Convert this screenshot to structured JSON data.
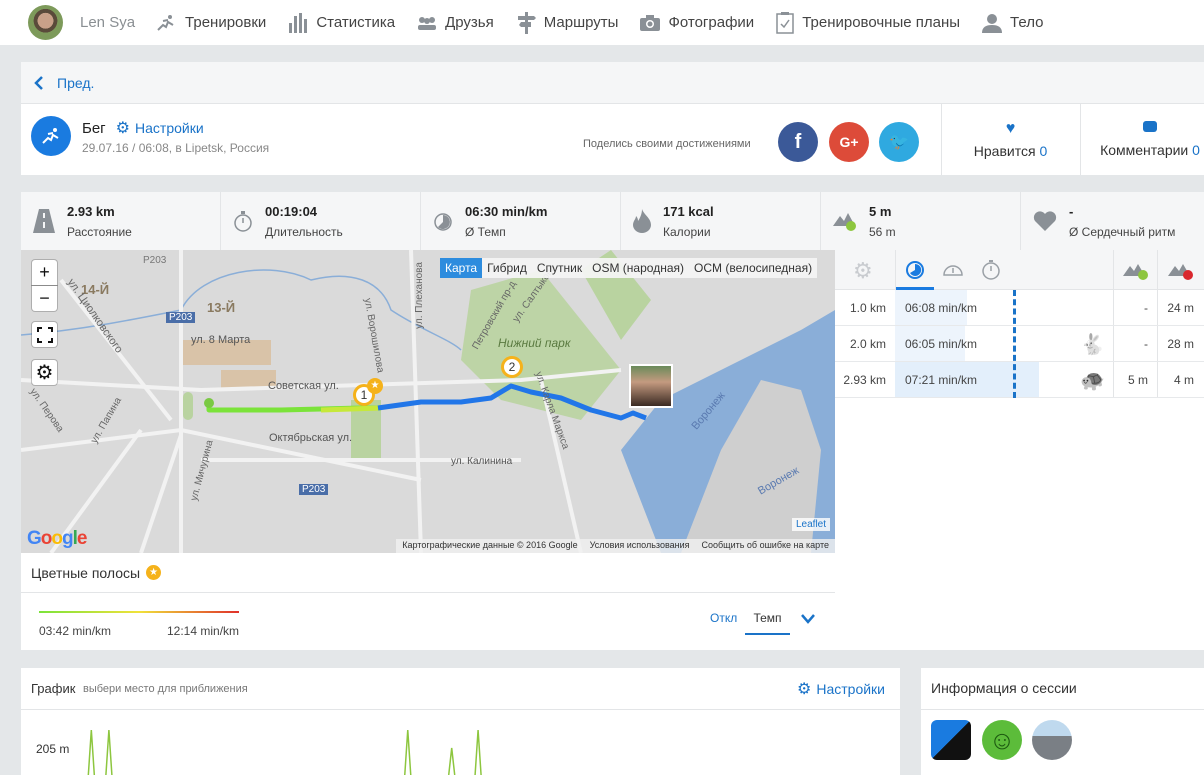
{
  "nav": {
    "user": "Len Sya",
    "items": [
      {
        "icon": "running-icon",
        "label": "Тренировки"
      },
      {
        "icon": "bar-chart-icon",
        "label": "Статистика"
      },
      {
        "icon": "friends-icon",
        "label": "Друзья"
      },
      {
        "icon": "signpost-icon",
        "label": "Маршруты"
      },
      {
        "icon": "camera-icon",
        "label": "Фотографии"
      },
      {
        "icon": "clipboard-check-icon",
        "label": "Тренировочные планы"
      },
      {
        "icon": "person-icon",
        "label": "Тело"
      }
    ]
  },
  "prev_label": "Пред.",
  "activity": {
    "type": "Бег",
    "settings_label": "Настройки",
    "meta": "29.07.16 / 06:08, в Lipetsk, Россия",
    "share_text": "Поделись своими достижениями",
    "likes_label": "Нравится",
    "likes_count": "0",
    "comments_label": "Комментарии",
    "comments_count": "0"
  },
  "colors": {
    "accent": "#1a7be0",
    "facebook": "#3b5998",
    "google": "#dd4b39",
    "twitter": "#2fa9e0",
    "route_blue": "#2176e8",
    "route_green": "#7be33a"
  },
  "stats": [
    {
      "icon": "road-icon",
      "value": "2.93 km",
      "label": "Расстояние"
    },
    {
      "icon": "stopwatch-icon",
      "value": "00:19:04",
      "label": "Длительность"
    },
    {
      "icon": "pace-icon",
      "value": "06:30 min/km",
      "label": "Ø Темп"
    },
    {
      "icon": "flame-icon",
      "value": "171 kcal",
      "label": "Калории"
    },
    {
      "icon": "elevation-icon",
      "value": "5 m",
      "label": "56 m"
    },
    {
      "icon": "heart-icon",
      "value": "-",
      "label": "Ø Сердечный ритм"
    }
  ],
  "map": {
    "types": [
      "Карта",
      "Гибрид",
      "Спутник",
      "OSM (народная)",
      "OCM (велосипедная)"
    ],
    "active_type": 0,
    "zoom_in": "+",
    "zoom_out": "−",
    "labels": [
      "14-Й",
      "13-Й",
      "P203",
      "P203",
      "P203",
      "ул. Циолковского",
      "ул. 8 Марта",
      "Советская ул.",
      "Октябрьская ул.",
      "ул. Мичурина",
      "ул. Перова",
      "ул. Папина",
      "ул. Ворошилова",
      "ул. Плеханова",
      "Петровский пр-д",
      "ул. Салтыкова",
      "Нижний парк",
      "ул. Карла Маркса",
      "ул. Калинина",
      "Воронеж",
      "Воронеж"
    ],
    "markers": [
      "1",
      "2"
    ],
    "leaflet": "Leaflet",
    "attribution": "Картографические данные © 2016 Google",
    "terms": "Условия использования",
    "report": "Сообщить об ошибке на карте"
  },
  "splits": {
    "rows": [
      {
        "dist": "1.0 km",
        "pace": "06:08 min/km",
        "pace_fraction": 0.33,
        "icon": "",
        "up": "-",
        "down": "24 m"
      },
      {
        "dist": "2.0 km",
        "pace": "06:05 min/km",
        "pace_fraction": 0.32,
        "icon": "rabbit-icon",
        "up": "-",
        "down": "28 m"
      },
      {
        "dist": "2.93 km",
        "pace": "07:21 min/km",
        "pace_fraction": 0.66,
        "icon": "turtle-icon",
        "up": "5 m",
        "down": "4 m"
      }
    ]
  },
  "colorbars": {
    "title": "Цветные полосы",
    "min": "03:42 min/km",
    "max": "12:14 min/km",
    "off": "Откл",
    "active": "Темп"
  },
  "graph": {
    "title": "График",
    "hint": "выбери место для приближения",
    "settings": "Настройки"
  },
  "info": {
    "title": "Информация о сессии"
  },
  "chart_data": {
    "type": "line",
    "ylabel_top": "205 m",
    "series": [
      {
        "name": "elevation",
        "x": [
          0.08,
          0.1,
          0.44,
          0.49,
          0.52
        ],
        "values": [
          205,
          205,
          205,
          199,
          205
        ]
      }
    ]
  }
}
